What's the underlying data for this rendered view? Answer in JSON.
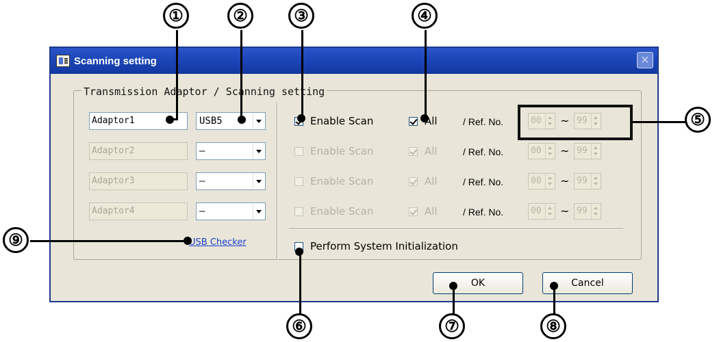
{
  "window": {
    "title": "Scanning setting",
    "close_glyph": "✕",
    "group_title": "Transmission Adaptor / Scanning setting"
  },
  "adaptors": [
    {
      "name": "Adaptor1",
      "port": "USB5",
      "enabled": true
    },
    {
      "name": "Adaptor2",
      "port": "–",
      "enabled": false
    },
    {
      "name": "Adaptor3",
      "port": "–",
      "enabled": false
    },
    {
      "name": "Adaptor4",
      "port": "–",
      "enabled": false
    }
  ],
  "scan_rows": [
    {
      "enable_label": "Enable Scan",
      "enable_checked": true,
      "all_label": "All",
      "all_checked": true,
      "ref_label": "/ Ref. No.",
      "from": "00",
      "to": "99",
      "active": true
    },
    {
      "enable_label": "Enable Scan",
      "enable_checked": false,
      "all_label": "All",
      "all_checked": true,
      "ref_label": "/ Ref. No.",
      "from": "00",
      "to": "99",
      "active": false
    },
    {
      "enable_label": "Enable Scan",
      "enable_checked": false,
      "all_label": "All",
      "all_checked": true,
      "ref_label": "/ Ref. No.",
      "from": "00",
      "to": "99",
      "active": false
    },
    {
      "enable_label": "Enable Scan",
      "enable_checked": false,
      "all_label": "All",
      "all_checked": true,
      "ref_label": "/ Ref. No.",
      "from": "00",
      "to": "99",
      "active": false
    }
  ],
  "range_separator": "~",
  "usb_checker": "USB Checker",
  "init": {
    "label": "Perform System Initialization",
    "checked": false
  },
  "buttons": {
    "ok": "OK",
    "cancel": "Cancel"
  },
  "callouts": [
    "①",
    "②",
    "③",
    "④",
    "⑤",
    "⑥",
    "⑦",
    "⑧",
    "⑨"
  ],
  "colors": {
    "title_bar": "#1c46b8",
    "dialog_bg": "#e9e6d9",
    "link": "#1a3ed0",
    "check": "#21a121"
  }
}
